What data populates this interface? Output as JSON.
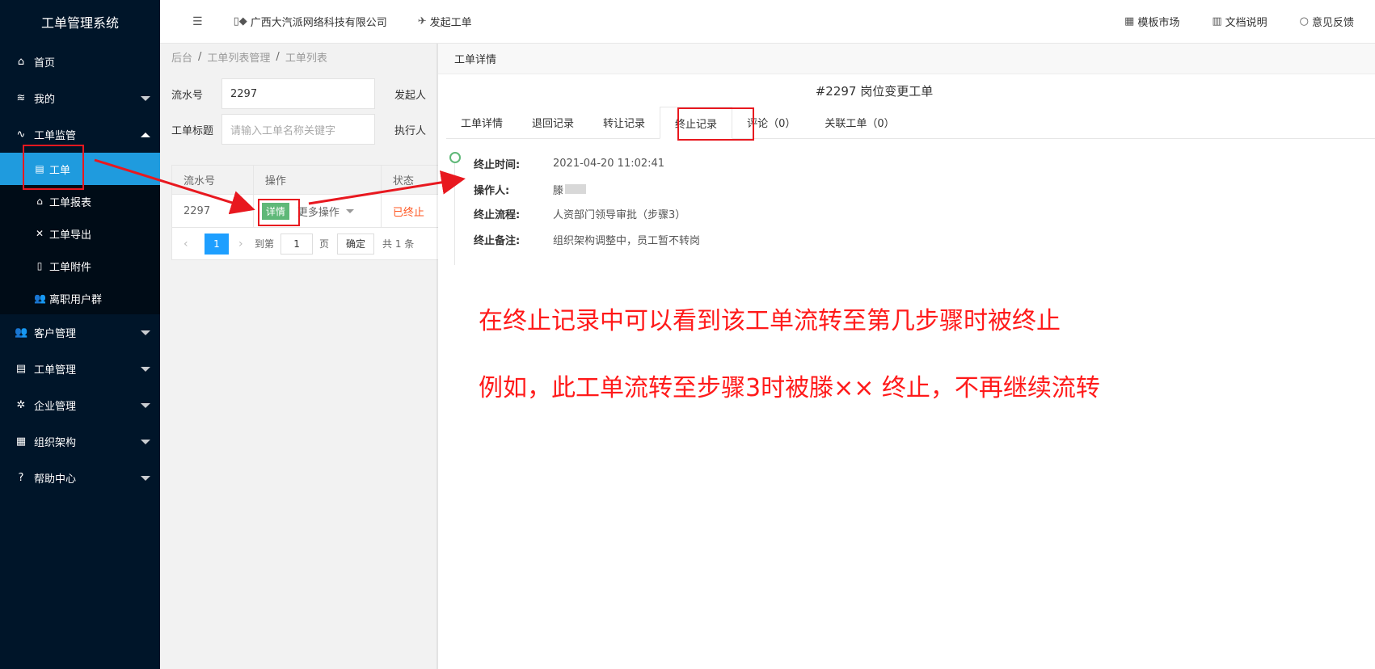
{
  "app": {
    "title": "工单管理系统"
  },
  "sidebar": {
    "items": [
      {
        "label": "首页",
        "icon": "home-icon",
        "glyph": "⌂"
      },
      {
        "label": "我的",
        "icon": "layers-icon",
        "glyph": "≋"
      },
      {
        "label": "工单监管",
        "icon": "activity-icon",
        "glyph": "∿"
      },
      {
        "label": "客户管理",
        "icon": "users-icon",
        "glyph": "👥"
      },
      {
        "label": "工单管理",
        "icon": "clipboard-icon",
        "glyph": "▤"
      },
      {
        "label": "企业管理",
        "icon": "gear-icon",
        "glyph": "✲"
      },
      {
        "label": "组织架构",
        "icon": "calendar-icon",
        "glyph": "▦"
      },
      {
        "label": "帮助中心",
        "icon": "help-icon",
        "glyph": "?"
      }
    ],
    "sub_items": [
      {
        "label": "工单",
        "icon": "document-icon",
        "glyph": "▤"
      },
      {
        "label": "工单报表",
        "icon": "home-icon",
        "glyph": "⌂"
      },
      {
        "label": "工单导出",
        "icon": "tools-icon",
        "glyph": "✕"
      },
      {
        "label": "工单附件",
        "icon": "file-icon",
        "glyph": "▯"
      },
      {
        "label": "离职用户群",
        "icon": "users-icon",
        "glyph": "👥"
      }
    ]
  },
  "topbar": {
    "menu_glyph": "☰",
    "company": "广西大汽派网络科技有限公司",
    "company_glyph": "▯◆",
    "new_ticket": "发起工单",
    "new_ticket_glyph": "✈",
    "template_market": "模板市场",
    "template_glyph": "▦",
    "docs": "文档说明",
    "docs_glyph": "▥",
    "feedback": "意见反馈",
    "feedback_glyph": "○"
  },
  "breadcrumb": [
    "后台",
    "工单列表管理",
    "工单列表"
  ],
  "breadcrumb_sep": "/",
  "filters": {
    "serial_label": "流水号",
    "serial_value": "2297",
    "initiator_label": "发起人",
    "title_label": "工单标题",
    "title_placeholder": "请输入工单名称关键字",
    "executor_label": "执行人"
  },
  "table": {
    "headers": [
      "流水号",
      "操作",
      "状态"
    ],
    "row": {
      "serial": "2297",
      "detail_btn": "详情",
      "more_ops": "更多操作",
      "status": "已终止"
    }
  },
  "pager": {
    "prev": "‹",
    "current": "1",
    "next": "›",
    "goto_label": "到第",
    "goto_value": "1",
    "page_label": "页",
    "confirm": "确定",
    "total": "共 1 条"
  },
  "panel": {
    "header": "工单详情",
    "title": "#2297 岗位变更工单",
    "tabs": [
      "工单详情",
      "退回记录",
      "转让记录",
      "终止记录",
      "评论（0）",
      "关联工单（0）"
    ],
    "active_tab": 3,
    "record": {
      "time_label": "终止时间:",
      "time_value": "2021-04-20 11:02:41",
      "operator_label": "操作人:",
      "operator_value": "滕",
      "flow_label": "终止流程:",
      "flow_value": "人资部门领导审批（步骤3）",
      "remark_label": "终止备注:",
      "remark_value": "组织架构调整中，员工暂不转岗"
    }
  },
  "annotations": {
    "line1": "在终止记录中可以看到该工单流转至第几步骤时被终止",
    "line2": "例如，此工单流转至步骤3时被滕×× 终止，不再继续流转",
    "color": "#ff1a1a"
  },
  "colors": {
    "sidebar_bg": "#001529",
    "active": "#1f9bde",
    "success": "#5fb878",
    "danger": "#ff5722"
  }
}
